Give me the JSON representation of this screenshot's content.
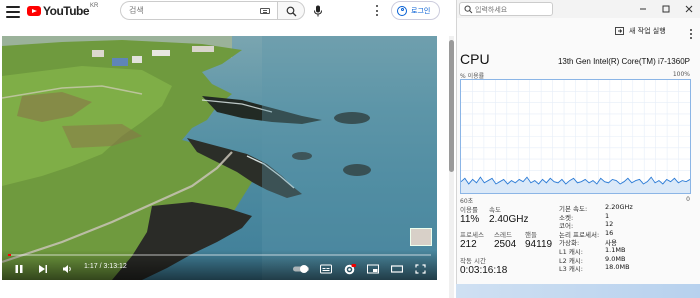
{
  "youtube": {
    "logo_text": "YouTube",
    "logo_region": "KR",
    "search": {
      "placeholder": "검색"
    },
    "login_label": "로그인",
    "player": {
      "time_display": "1:17 / 3:13:12",
      "progress_fraction": 0.007
    },
    "icons": {
      "menu": "hamburger-menu-icon",
      "search": "magnifier-icon",
      "keyboard": "keyboard-icon",
      "voice": "microphone-icon",
      "more": "kebab-icon",
      "account": "person-circle-icon"
    }
  },
  "task_manager": {
    "search_placeholder": "입력하세요",
    "new_task_label": "새 작업 실행",
    "cpu": {
      "title": "CPU",
      "model": "13th Gen Intel(R) Core(TM) i7-1360P",
      "usage_label": "% 이용률",
      "max_label": "100%",
      "time_span_label": "60초",
      "min_label": "0",
      "utilization_label": "이용률",
      "utilization_value": "11%",
      "speed_label": "속도",
      "speed_value": "2.40GHz",
      "processes_label": "프로세스",
      "processes_value": "212",
      "threads_label": "스레드",
      "threads_value": "2504",
      "handles_label": "핸들",
      "handles_value": "94119",
      "uptime_label": "작동 시간",
      "uptime_value": "0:03:16:18",
      "specs": [
        {
          "key": "기본 속도:",
          "value": "2.20GHz"
        },
        {
          "key": "소켓:",
          "value": "1"
        },
        {
          "key": "코어:",
          "value": "12"
        },
        {
          "key": "논리 프로세서:",
          "value": "16"
        },
        {
          "key": "가상화:",
          "value": "사용"
        },
        {
          "key": "L1 캐시:",
          "value": "1.1MB"
        },
        {
          "key": "L2 캐시:",
          "value": "9.0MB"
        },
        {
          "key": "L3 캐시:",
          "value": "18.0MB"
        }
      ]
    },
    "colors": {
      "graph_line": "#2b7bd6",
      "graph_border": "#8bb5e6"
    }
  },
  "chart_data": {
    "type": "area",
    "title": "",
    "xlabel": "60초",
    "ylabel": "% 이용률",
    "ylim": [
      0,
      100
    ],
    "series": [
      {
        "values": [
          10,
          13,
          8,
          12,
          9,
          14,
          9,
          11,
          13,
          8,
          10,
          12,
          8,
          11,
          9,
          12,
          10,
          14,
          9,
          11,
          8,
          12,
          9,
          13,
          10,
          9,
          12,
          8,
          11,
          13,
          9,
          10,
          12,
          9,
          11,
          8,
          13,
          10,
          9,
          12,
          11,
          8,
          10,
          13,
          9,
          11,
          12,
          8,
          10,
          14,
          9,
          11,
          8,
          12,
          10,
          13,
          9,
          11,
          10,
          12
        ]
      }
    ]
  }
}
